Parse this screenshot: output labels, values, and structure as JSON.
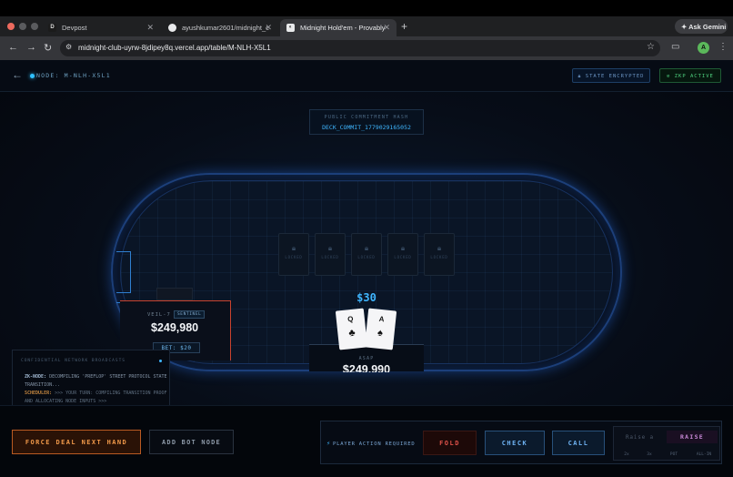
{
  "browser": {
    "tabs": [
      {
        "title": "Devpost",
        "favicon": "D"
      },
      {
        "title": "ayushkumar2601/midnight_c",
        "favicon": "github-icon"
      },
      {
        "title": "Midnight Hold'em - Provably",
        "favicon": "midnight-icon"
      }
    ],
    "new_tab": "+",
    "gemini_label": "Ask Gemini",
    "url": "midnight-club-uyrw-8jdipey8q.vercel.app/table/M-NLH-X5L1",
    "profile_initial": "A"
  },
  "header": {
    "node_label": "NODE: M-NLH-X5L1",
    "state_chip": "STATE ENCRYPTED",
    "zkp_chip": "ZKP ACTIVE"
  },
  "commitment": {
    "title": "PUBLIC COMMITMENT HASH",
    "value": "DECK_COMMIT_1779029165052"
  },
  "community_cards": [
    {
      "label": "LOCKED"
    },
    {
      "label": "LOCKED"
    },
    {
      "label": "LOCKED"
    },
    {
      "label": "LOCKED"
    },
    {
      "label": "LOCKED"
    }
  ],
  "pot": "$30",
  "seats": {
    "left": {
      "name": "VEIL-7",
      "badge": "SENTINEL",
      "stack": "$249,980",
      "bet": "BET: $20"
    },
    "hero": {
      "name": "ASAP",
      "stack": "$249,990",
      "cards": [
        {
          "rank": "Q",
          "suit": "♣"
        },
        {
          "rank": "A",
          "suit": "♠"
        }
      ]
    }
  },
  "log": {
    "title": "CONFIDENTIAL NETWORK BROADCASTS",
    "lines": [
      {
        "tag": "ZK-NODE:",
        "text": " DECOMPILING 'PREFLOP' STREET PROTOCOL STATE TRANSITION..."
      },
      {
        "tag": "SCHEDULER:",
        "text": " >>> YOUR TURN: COMPILING TRANSITION PROOF AND ALLOCATING NODE INPUTS >>>"
      }
    ]
  },
  "controls": {
    "force_deal": "FORCE DEAL NEXT HAND",
    "add_bot": "ADD BOT NODE",
    "required": "PLAYER ACTION REQUIRED",
    "fold": "FOLD",
    "check": "CHECK",
    "call": "CALL",
    "raise_placeholder": "Raise a",
    "raise": "RAISE",
    "presets": [
      "2x",
      "3x",
      "POT",
      "ALL-IN"
    ]
  },
  "colors": {
    "accent": "#3fb6ff",
    "danger": "#e0524a",
    "force": "#f29a4a",
    "zkp": "#4fd17f",
    "raise": "#c98ad8"
  }
}
